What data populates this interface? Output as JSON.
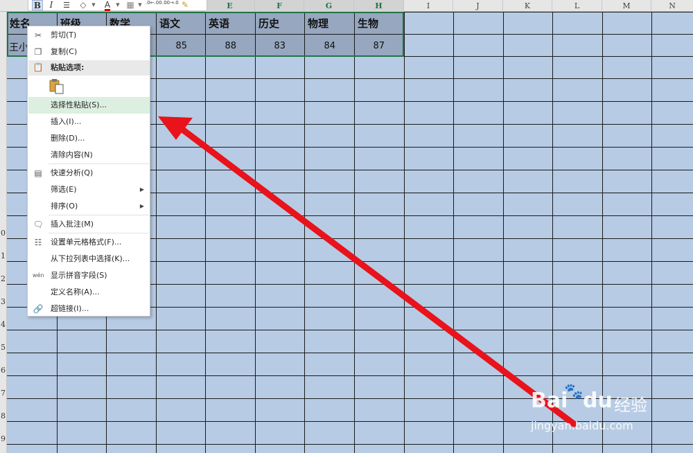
{
  "columns": [
    "E",
    "F",
    "G",
    "H",
    "I",
    "J",
    "K",
    "L",
    "M",
    "N"
  ],
  "row_numbers": [
    "0",
    "1",
    "2",
    "3",
    "4",
    "5",
    "6",
    "7",
    "8",
    "9"
  ],
  "table": {
    "header": [
      "姓名",
      "班级",
      "数学",
      "语文",
      "英语",
      "历史",
      "物理",
      "生物"
    ],
    "row1": {
      "name": "王小",
      "scores": [
        "85",
        "88",
        "83",
        "84",
        "87"
      ]
    }
  },
  "toolbar": {
    "bold": "B",
    "italic": "I",
    "align": "☰",
    "fill": "◇",
    "font_color": "A",
    "border": "▦",
    "dec_inc": ".0←.00",
    "dec_dec": ".00→.0",
    "format_painter": "✎"
  },
  "menu": {
    "cut": "剪切(T)",
    "copy": "复制(C)",
    "paste_options": "粘贴选项:",
    "paste_special": "选择性粘贴(S)...",
    "insert": "插入(I)...",
    "delete": "删除(D)...",
    "clear": "清除内容(N)",
    "quick_analysis": "快速分析(Q)",
    "filter": "筛选(E)",
    "sort": "排序(O)",
    "insert_comment": "插入批注(M)",
    "format_cells": "设置单元格格式(F)...",
    "pick_list": "从下拉列表中选择(K)...",
    "phonetic": "显示拼音字段(S)",
    "define_name": "定义名称(A)...",
    "hyperlink": "超链接(I)..."
  },
  "watermark": {
    "brand": "Bai",
    "brand2": "du",
    "cn": "经验",
    "url": "jingyan.baidu.com"
  },
  "colors": {
    "cell_bg": "#b7cbe4",
    "selection_border": "#217346",
    "arrow": "#e8131b",
    "menu_highlight": "#dcefe0"
  }
}
